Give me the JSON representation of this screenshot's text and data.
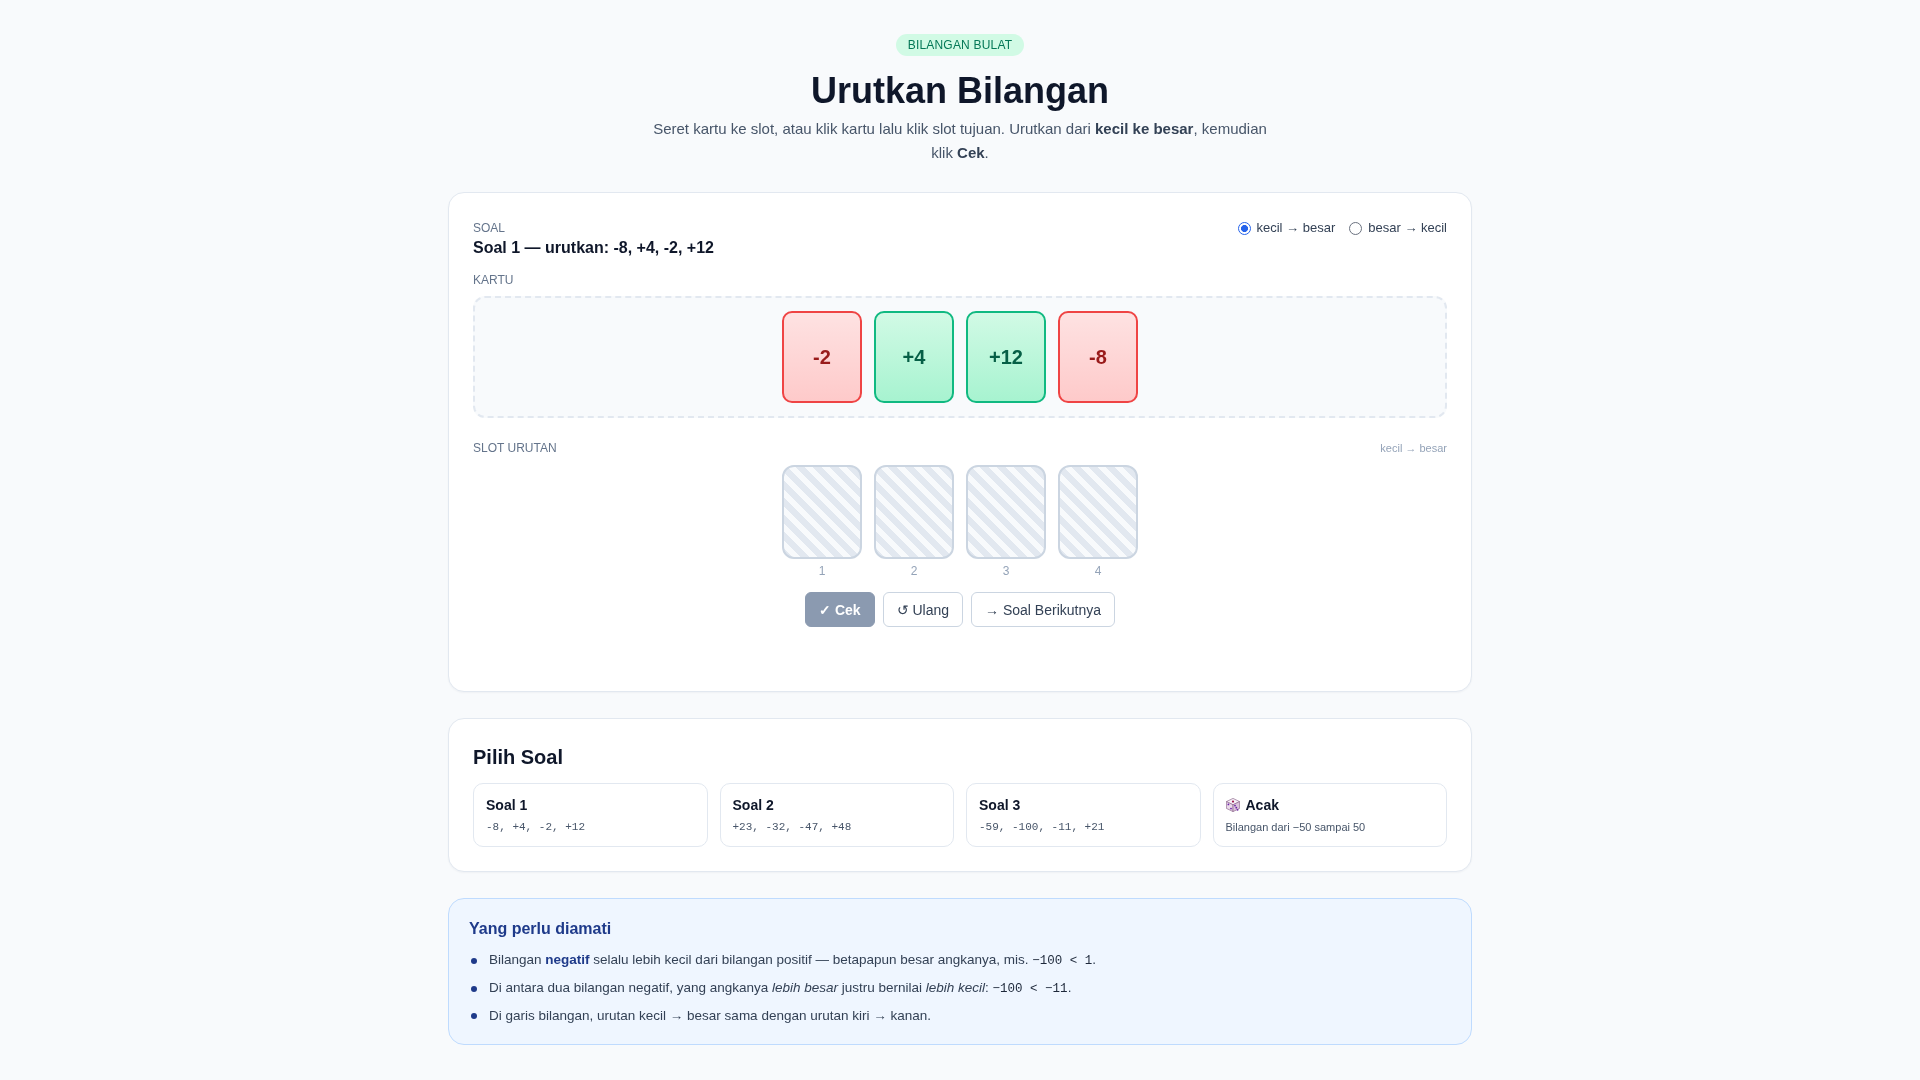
{
  "header": {
    "badge": "BILANGAN BULAT",
    "title": "Urutkan Bilangan",
    "subtitle": "Seret kartu ke slot, atau klik kartu lalu klik slot tujuan. Urutkan dari **kecil ke besar**, kemudian klik **Cek**."
  },
  "exercise": {
    "question_label": "SOAL",
    "question": "Soal 1 — urutkan: -8, +4, -2, +12",
    "order_options": [
      {
        "label": "kecil → besar",
        "selected": true
      },
      {
        "label": "besar → kecil",
        "selected": false
      }
    ],
    "cards_label": "KARTU",
    "cards": [
      {
        "value": "-2",
        "kind": "negative"
      },
      {
        "value": "+4",
        "kind": "positive"
      },
      {
        "value": "+12",
        "kind": "positive"
      },
      {
        "value": "-8",
        "kind": "negative"
      }
    ],
    "slots_label": "SLOT URUTAN",
    "slots_hint": "kecil → besar",
    "slots": [
      "1",
      "2",
      "3",
      "4"
    ],
    "buttons": [
      {
        "label": "✓ Cek",
        "disabled": true
      },
      {
        "label": "↺ Ulang",
        "disabled": false
      },
      {
        "label": "→ Soal Berikutnya",
        "disabled": false
      }
    ]
  },
  "problem_picker": {
    "title": "Pilih Soal",
    "items": [
      {
        "title": "Soal 1",
        "detail": "-8, +4, -2, +12",
        "kind": "preset"
      },
      {
        "title": "Soal 2",
        "detail": "+23, -32, -47, +48",
        "kind": "preset"
      },
      {
        "title": "Soal 3",
        "detail": "-59, -100, -11, +21",
        "kind": "preset"
      },
      {
        "title": "Acak",
        "detail": "Bilangan dari −50 sampai 50",
        "kind": "random"
      }
    ]
  },
  "notes": {
    "title": "Yang perlu diamati",
    "items": [
      {
        "parts": [
          {
            "kind": "text",
            "text": "Bilangan **negatif** selalu lebih kecil dari bilangan positif — betapapun besar angkanya, mis. "
          },
          {
            "kind": "code",
            "text": "−100 < 1"
          },
          {
            "kind": "text",
            "text": "."
          }
        ]
      },
      {
        "parts": [
          {
            "kind": "text",
            "text": "Di antara dua bilangan negatif, yang angkanya *lebih besar* justru bernilai *lebih kecil*: "
          },
          {
            "kind": "code",
            "text": "−100 < −11"
          },
          {
            "kind": "text",
            "text": "."
          }
        ]
      },
      {
        "parts": [
          {
            "kind": "text",
            "text": "Di garis bilangan, urutan kecil → besar sama dengan urutan kiri → kanan."
          }
        ]
      }
    ]
  }
}
